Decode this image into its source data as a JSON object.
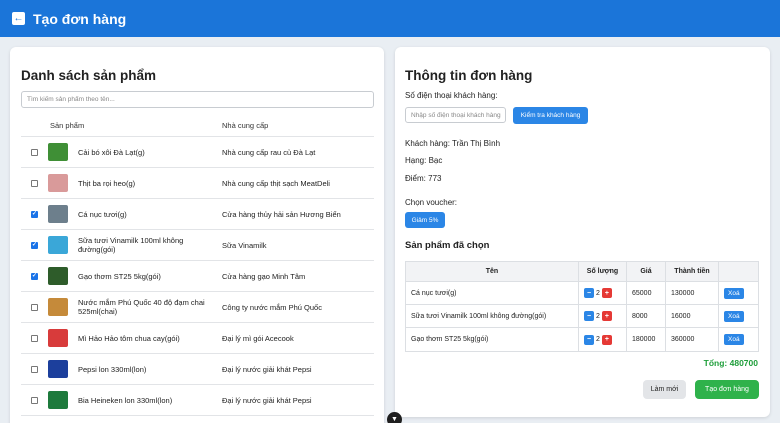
{
  "header": {
    "title": "Tạo đơn hàng",
    "back_icon": "arrow-left-icon"
  },
  "products_panel": {
    "title": "Danh sách sản phẩm",
    "search_placeholder": "Tìm kiếm sản phẩm theo tên...",
    "columns": {
      "product": "Sản phẩm",
      "supplier": "Nhà cung cấp"
    },
    "rows": [
      {
        "name": "Cải bó xôi Đà Lạt(g)",
        "supplier": "Nhà cung cấp rau củ Đà Lạt",
        "checked": false,
        "thumb_color": "#3f8f36"
      },
      {
        "name": "Thịt ba rọi heo(g)",
        "supplier": "Nhà cung cấp thịt sạch MeatDeli",
        "checked": false,
        "thumb_color": "#d99a9a"
      },
      {
        "name": "Cá nục tươi(g)",
        "supplier": "Cửa hàng thủy hải sản Hương Biển",
        "checked": true,
        "thumb_color": "#6d7f8c"
      },
      {
        "name": "Sữa tươi Vinamilk 100ml không đường(gói)",
        "supplier": "Sữa Vinamilk",
        "checked": true,
        "thumb_color": "#3aa7d8"
      },
      {
        "name": "Gạo thơm ST25 5kg(gói)",
        "supplier": "Cửa hàng gạo Minh Tâm",
        "checked": true,
        "thumb_color": "#2e5c2a"
      },
      {
        "name": "Nước mắm Phú Quốc 40 độ đạm chai 525ml(chai)",
        "supplier": "Công ty nước mắm Phú Quốc",
        "checked": false,
        "thumb_color": "#c58a3a"
      },
      {
        "name": "Mì Hảo Hảo tôm chua cay(gói)",
        "supplier": "Đại lý mì gói Acecook",
        "checked": false,
        "thumb_color": "#d83b3b"
      },
      {
        "name": "Pepsi lon 330ml(lon)",
        "supplier": "Đại lý nước giải khát Pepsi",
        "checked": false,
        "thumb_color": "#1c3f9c"
      },
      {
        "name": "Bia Heineken lon 330ml(lon)",
        "supplier": "Đại lý nước giải khát Pepsi",
        "checked": false,
        "thumb_color": "#1d7a3c"
      }
    ]
  },
  "order_panel": {
    "title": "Thông tin đơn hàng",
    "phone_label": "Số điện thoại khách hàng:",
    "phone_placeholder": "Nhập số điện thoại khách hàng",
    "check_button": "Kiểm tra khách hàng",
    "customer_line": "Khách hàng: Trần Thị Bình",
    "tier_line": "Hạng: Bạc",
    "points_line": "Điểm: 773",
    "voucher_label": "Chọn voucher:",
    "voucher_button": "Giảm 5%",
    "selected_title": "Sản phẩm đã chọn",
    "columns": {
      "name": "Tên",
      "qty": "Số lượng",
      "price": "Giá",
      "total": "Thành tiền",
      "action": ""
    },
    "items": [
      {
        "name": "Cá nục tươi(g)",
        "qty": "2",
        "price": "65000",
        "total": "130000",
        "delete": "Xoá"
      },
      {
        "name": "Sữa tươi Vinamilk 100ml không đường(gói)",
        "qty": "2",
        "price": "8000",
        "total": "16000",
        "delete": "Xoá"
      },
      {
        "name": "Gạo thơm ST25 5kg(gói)",
        "qty": "2",
        "price": "180000",
        "total": "360000",
        "delete": "Xoá"
      }
    ],
    "total_label": "Tổng:",
    "total_value": "480700",
    "reset_button": "Làm mới",
    "create_button": "Tạo đơn hàng"
  },
  "colors": {
    "primary": "#1b75d9",
    "danger": "#e53935",
    "success": "#2fb24b",
    "total_text": "#1e9e3a"
  }
}
